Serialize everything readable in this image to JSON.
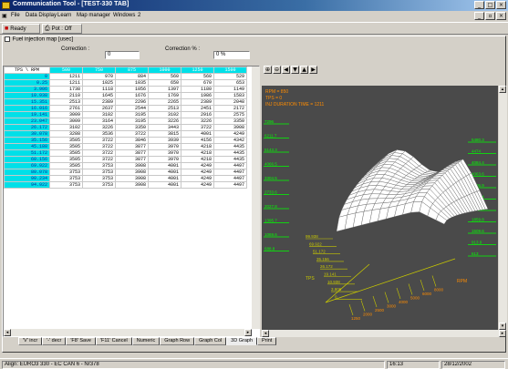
{
  "window": {
    "title": "Communication Tool - [TEST-330 TAB]"
  },
  "menu": {
    "items": [
      "File",
      "Data Display",
      "Learn",
      "Map manager",
      "Windows",
      "2"
    ]
  },
  "toolbar": {
    "ready_label": "Ready",
    "print_label": "Pot : Off"
  },
  "child": {
    "title": "Fuel injection map [usec]"
  },
  "correction": {
    "label": "Correction :",
    "value": "0",
    "pct_label": "Correction % :",
    "pct_value": "0   %"
  },
  "table": {
    "corner": "TPS \\ RPM",
    "columns": [
      "500",
      "750",
      "875",
      "1000",
      "1250",
      "1500"
    ],
    "rows": [
      {
        "head": "0",
        "cells": [
          "1211",
          "970",
          "884",
          "560",
          "560",
          "529"
        ]
      },
      {
        "head": "0.25",
        "cells": [
          "1211",
          "1025",
          "1035",
          "650",
          "670",
          "653"
        ]
      },
      {
        "head": "3.906",
        "cells": [
          "1738",
          "1118",
          "1056",
          "1397",
          "1180",
          "1149"
        ]
      },
      {
        "head": "10.938",
        "cells": [
          "2110",
          "1645",
          "1676",
          "1769",
          "1986",
          "1583"
        ]
      },
      {
        "head": "15.351",
        "cells": [
          "2513",
          "2389",
          "2296",
          "2265",
          "2389",
          "2048"
        ]
      },
      {
        "head": "16.016",
        "cells": [
          "2761",
          "2637",
          "2544",
          "2513",
          "2451",
          "2172"
        ]
      },
      {
        "head": "19.141",
        "cells": [
          "3009",
          "3102",
          "3195",
          "3102",
          "2916",
          "2575"
        ]
      },
      {
        "head": "23.047",
        "cells": [
          "3009",
          "3164",
          "3195",
          "3226",
          "3226",
          "3350"
        ]
      },
      {
        "head": "26.172",
        "cells": [
          "3102",
          "3226",
          "3350",
          "3443",
          "3722",
          "3908"
        ]
      },
      {
        "head": "30.078",
        "cells": [
          "3288",
          "3536",
          "3722",
          "3815",
          "4001",
          "4249"
        ]
      },
      {
        "head": "35.156",
        "cells": [
          "3505",
          "3722",
          "3846",
          "3939",
          "4156",
          "4342"
        ]
      },
      {
        "head": "45.188",
        "cells": [
          "3505",
          "3722",
          "3877",
          "3970",
          "4218",
          "4435"
        ]
      },
      {
        "head": "51.172",
        "cells": [
          "3505",
          "3722",
          "3877",
          "3970",
          "4218",
          "4435"
        ]
      },
      {
        "head": "60.156",
        "cells": [
          "3505",
          "3722",
          "3877",
          "3970",
          "4218",
          "4435"
        ]
      },
      {
        "head": "69.922",
        "cells": [
          "3505",
          "3753",
          "3908",
          "4001",
          "4249",
          "4497"
        ]
      },
      {
        "head": "80.078",
        "cells": [
          "3753",
          "3753",
          "3908",
          "4001",
          "4249",
          "4497"
        ]
      },
      {
        "head": "90.234",
        "cells": [
          "3753",
          "3753",
          "3908",
          "4001",
          "4249",
          "4497"
        ]
      },
      {
        "head": "94.922",
        "cells": [
          "3753",
          "3753",
          "3908",
          "4001",
          "4249",
          "4497"
        ]
      }
    ]
  },
  "graph": {
    "info": [
      "RPM = 850",
      "TPS = 0",
      "INJ DURATION TIME = 1211"
    ],
    "left_ticks": [
      "7296",
      "6211.7",
      "5143.3",
      "4066.5",
      "3304.5",
      "2733.6",
      "2027.8",
      "1395.7",
      "1069.6",
      "688.8"
    ],
    "right_ticks": [
      "5480.3",
      "4474",
      "4084.4",
      "4063.6",
      "3706.9",
      "3627.4",
      "3244.7",
      "1859.8",
      "1509.6",
      "913.9",
      "613"
    ],
    "tps_ticks": [
      "99.938",
      "69.922",
      "51.172",
      "35.156",
      "26.172",
      "19.141",
      "10.938",
      "3.906",
      "0"
    ],
    "rpm_ticks": [
      "1250",
      "2000",
      "2500",
      "3000",
      "4000",
      "5000",
      "6000",
      "8000"
    ],
    "axis_tps": "TPS",
    "axis_rpm": "RPM",
    "colors": {
      "bg": "#4a4a4a",
      "axis": "#c8c800",
      "tick": "#00ff00",
      "info": "#ff8c00",
      "mesh": "#ffffff",
      "mesh_line": "#606060"
    }
  },
  "tabs": [
    "'V' incr",
    "'-' decr",
    "'F8' Save",
    "'F11' Cancel",
    "Numeric",
    "Graph Row",
    "Graph Col",
    "3D Graph",
    "Print"
  ],
  "status": {
    "left": "Align: EURO3 330 - EC CAN 6 - Nr378",
    "time": "16:13",
    "date": "28/12/2002"
  }
}
